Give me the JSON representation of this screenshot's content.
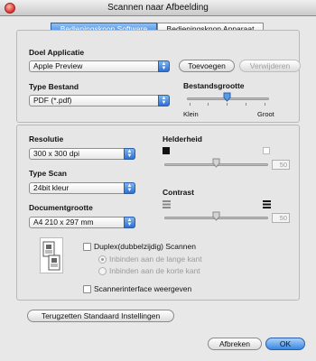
{
  "window": {
    "title": "Scannen naar Afbeelding"
  },
  "tabs": [
    {
      "label": "Bedieningsknop Software",
      "active": true
    },
    {
      "label": "Bedieningsknop Apparaat",
      "active": false
    }
  ],
  "app_section": {
    "label": "Doel Applicatie",
    "selected": "Apple Preview",
    "add_label": "Toevoegen",
    "remove_label": "Verwijderen"
  },
  "file_section": {
    "type_label": "Type Bestand",
    "type_selected": "PDF (*.pdf)",
    "size_label": "Bestandsgrootte",
    "size_min": "Klein",
    "size_max": "Groot",
    "size_level": 0.5
  },
  "scan_settings": {
    "resolution_label": "Resolutie",
    "resolution_selected": "300 x 300 dpi",
    "scan_type_label": "Type Scan",
    "scan_type_selected": "24bit kleur",
    "doc_size_label": "Documentgrootte",
    "doc_size_selected": "A4  210 x 297 mm",
    "brightness_label": "Helderheid",
    "brightness_value": "50",
    "contrast_label": "Contrast",
    "contrast_value": "50"
  },
  "duplex": {
    "label": "Duplex(dubbelzijdig) Scannen",
    "long_edge": "Inbinden aan de lange kant",
    "short_edge": "Inbinden aan de korte kant"
  },
  "scanner_interface_label": "Scannerinterface weergeven",
  "reset_label": "Terugzetten Standaard Instellingen",
  "cancel_label": "Afbreken",
  "ok_label": "OK"
}
